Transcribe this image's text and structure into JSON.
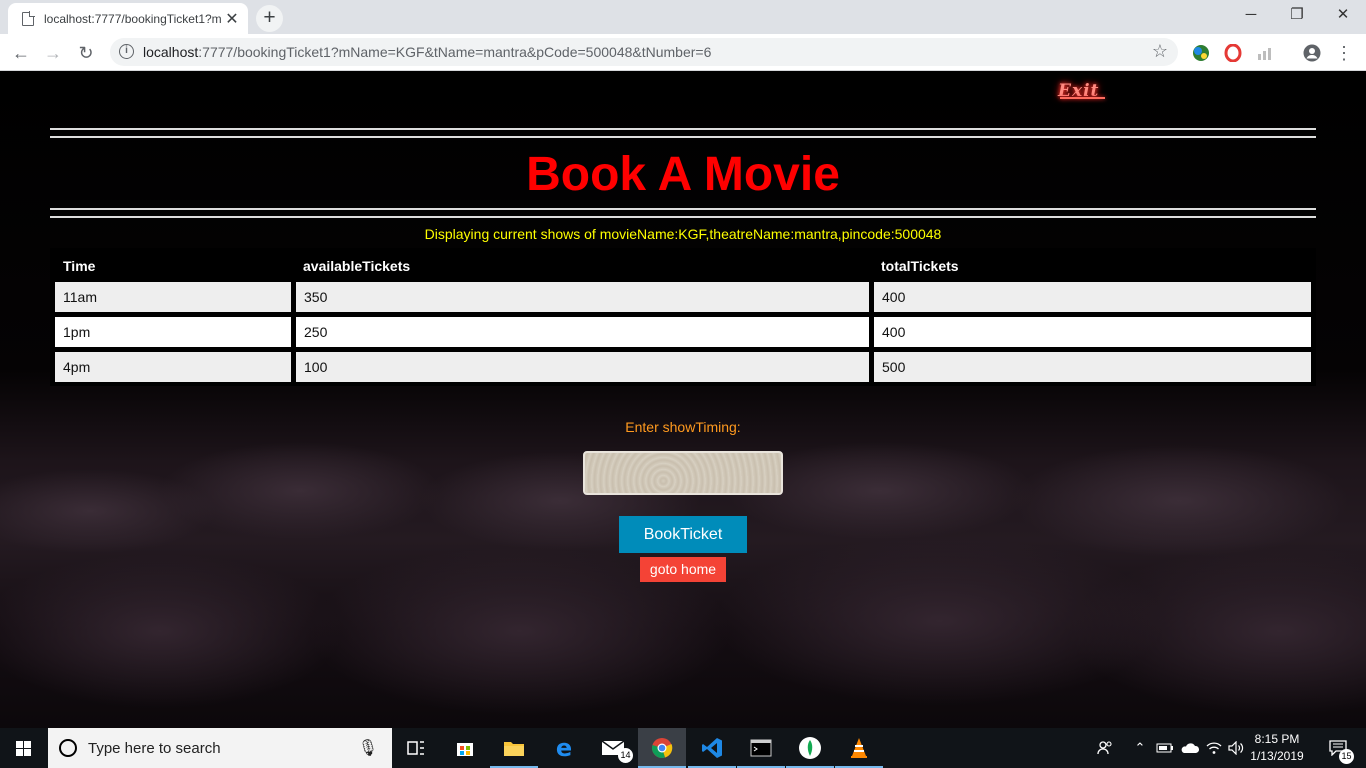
{
  "browser": {
    "tab_title": "localhost:7777/bookingTicket1?m",
    "tab_close": "✕",
    "new_tab": "+",
    "url_host": "localhost",
    "url_rest": ":7777/bookingTicket1?mName=KGF&tName=mantra&pCode=500048&tNumber=6",
    "window_controls": {
      "minimize": "─",
      "restore": "❐",
      "close": "✕"
    }
  },
  "page": {
    "exit_sign": "Exit",
    "heading": "Book A Movie",
    "caption": "Displaying current shows of movieName:KGF,theatreName:mantra,pincode:500048",
    "table": {
      "headers": [
        "Time",
        "availableTickets",
        "totalTickets"
      ],
      "rows": [
        [
          "11am",
          "350",
          "400"
        ],
        [
          "1pm",
          "250",
          "400"
        ],
        [
          "4pm",
          "100",
          "500"
        ]
      ]
    },
    "show_timing_label": "Enter showTiming:",
    "show_timing_value": "",
    "book_button": "BookTicket",
    "home_button": "goto home"
  },
  "taskbar": {
    "search_placeholder": "Type here to search",
    "mail_badge": "14",
    "time": "8:15 PM",
    "date": "1/13/2019",
    "notification_badge": "15"
  }
}
